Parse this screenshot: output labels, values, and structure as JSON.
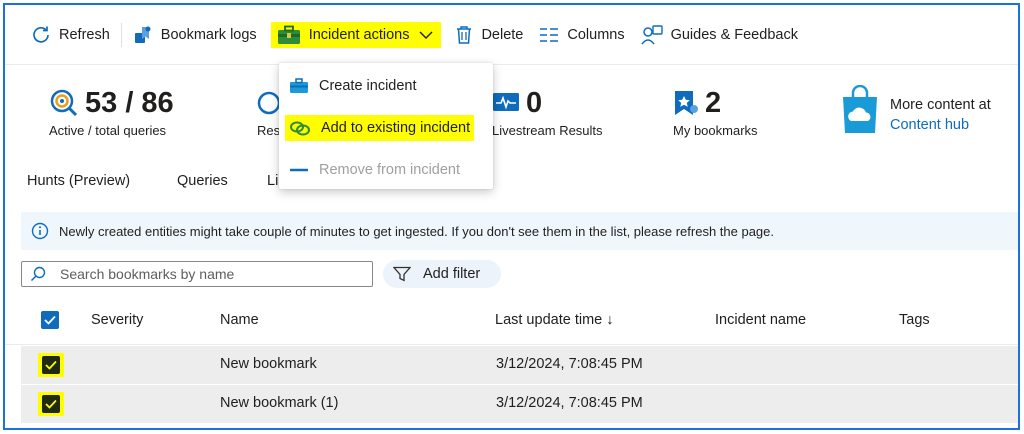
{
  "toolbar": {
    "refresh": "Refresh",
    "bookmark_logs": "Bookmark logs",
    "incident_actions": "Incident actions",
    "delete": "Delete",
    "columns": "Columns",
    "guides": "Guides & Feedback"
  },
  "incident_menu": {
    "create": "Create incident",
    "add_existing": "Add to existing incident",
    "remove": "Remove from incident"
  },
  "stats": {
    "queries_value": "53 / 86",
    "queries_label": "Active / total queries",
    "results_label_partial": "Res",
    "livestream_value": "0",
    "livestream_label": "Livestream Results",
    "bookmarks_value": "2",
    "bookmarks_label": "My bookmarks",
    "hub_text": "More content at",
    "hub_link": "Content hub"
  },
  "tabs": [
    "Hunts (Preview)",
    "Queries",
    "Li"
  ],
  "info_message": "Newly created entities might take couple of minutes to get ingested. If you don't see them in the list, please refresh the page.",
  "search": {
    "placeholder": "Search bookmarks by name"
  },
  "filter_label": "Add filter",
  "grid": {
    "columns": [
      "Severity",
      "Name",
      "Last update time ↓",
      "Incident name",
      "Tags"
    ],
    "rows": [
      {
        "severity": "",
        "name": "New bookmark",
        "last_update": "3/12/2024, 7:08:45 PM",
        "incident": "",
        "tags": ""
      },
      {
        "severity": "",
        "name": "New bookmark (1)",
        "last_update": "3/12/2024, 7:08:45 PM",
        "incident": "",
        "tags": ""
      }
    ]
  },
  "colors": {
    "accent": "#0f6cbd",
    "highlight": "#fefe00",
    "frame": "#1a73d9",
    "selected_row": "#ededed"
  },
  "icons": [
    "refresh-icon",
    "bookmark-logs-icon",
    "briefcase-icon",
    "chevron-down-icon",
    "trash-icon",
    "columns-icon",
    "guides-icon",
    "query-icon",
    "livestream-icon",
    "bookmark-icon",
    "content-hub-bag-icon",
    "info-icon",
    "search-icon",
    "filter-icon",
    "checkbox-icon",
    "link-icon",
    "minus-icon"
  ]
}
